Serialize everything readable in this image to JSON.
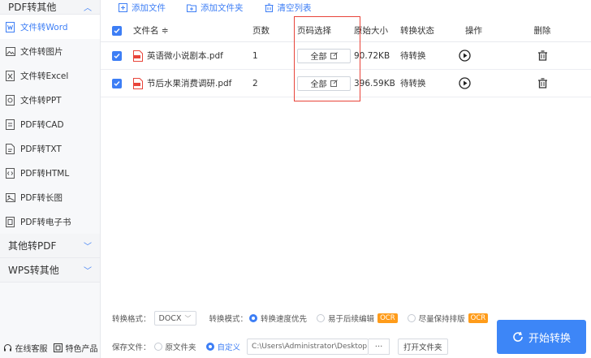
{
  "sidebar": {
    "top_section": "PDF转其他",
    "items": [
      {
        "label": "文件转Word",
        "icon": "word-icon",
        "active": true
      },
      {
        "label": "文件转图片",
        "icon": "image-icon"
      },
      {
        "label": "文件转Excel",
        "icon": "excel-icon"
      },
      {
        "label": "文件转PPT",
        "icon": "ppt-icon"
      },
      {
        "label": "PDF转CAD",
        "icon": "cad-icon"
      },
      {
        "label": "PDF转TXT",
        "icon": "txt-icon"
      },
      {
        "label": "PDF转HTML",
        "icon": "html-icon"
      },
      {
        "label": "PDF转长图",
        "icon": "long-image-icon"
      },
      {
        "label": "PDF转电子书",
        "icon": "ebook-icon"
      }
    ],
    "section_2": "其他转PDF",
    "section_3": "WPS转其他",
    "footer": {
      "service": "在线客服",
      "products": "特色产品"
    }
  },
  "toolbar": {
    "add_file": "添加文件",
    "add_folder": "添加文件夹",
    "clear_list": "清空列表"
  },
  "table": {
    "headers": {
      "name": "文件名 ≑",
      "pages": "页数",
      "range": "页码选择",
      "size": "原始大小",
      "status": "转换状态",
      "op": "操作",
      "del": "删除"
    },
    "rows": [
      {
        "name": "英语微小说剧本.pdf",
        "pages": "1",
        "range": "全部",
        "size": "90.72KB",
        "status": "待转换"
      },
      {
        "name": "节后水果消费调研.pdf",
        "pages": "2",
        "range": "全部",
        "size": "396.59KB",
        "status": "待转换"
      }
    ]
  },
  "options": {
    "format_label": "转换格式：",
    "format_value": "DOCX",
    "mode_label": "转换模式：",
    "mode_1": "转换速度优先",
    "mode_2": "易于后续编辑",
    "mode_3": "尽量保持排版",
    "ocr": "OCR",
    "save_label": "保存文件：",
    "save_1": "原文件夹",
    "save_2": "自定义",
    "path": "C:\\Users\\Administrator\\Desktop",
    "dots": "···",
    "open_folder": "打开文件夹"
  },
  "start_button": "开始转换",
  "colors": {
    "accent": "#3d86f7",
    "highlight": "#e8443a",
    "ocr": "#ff9c1a"
  }
}
